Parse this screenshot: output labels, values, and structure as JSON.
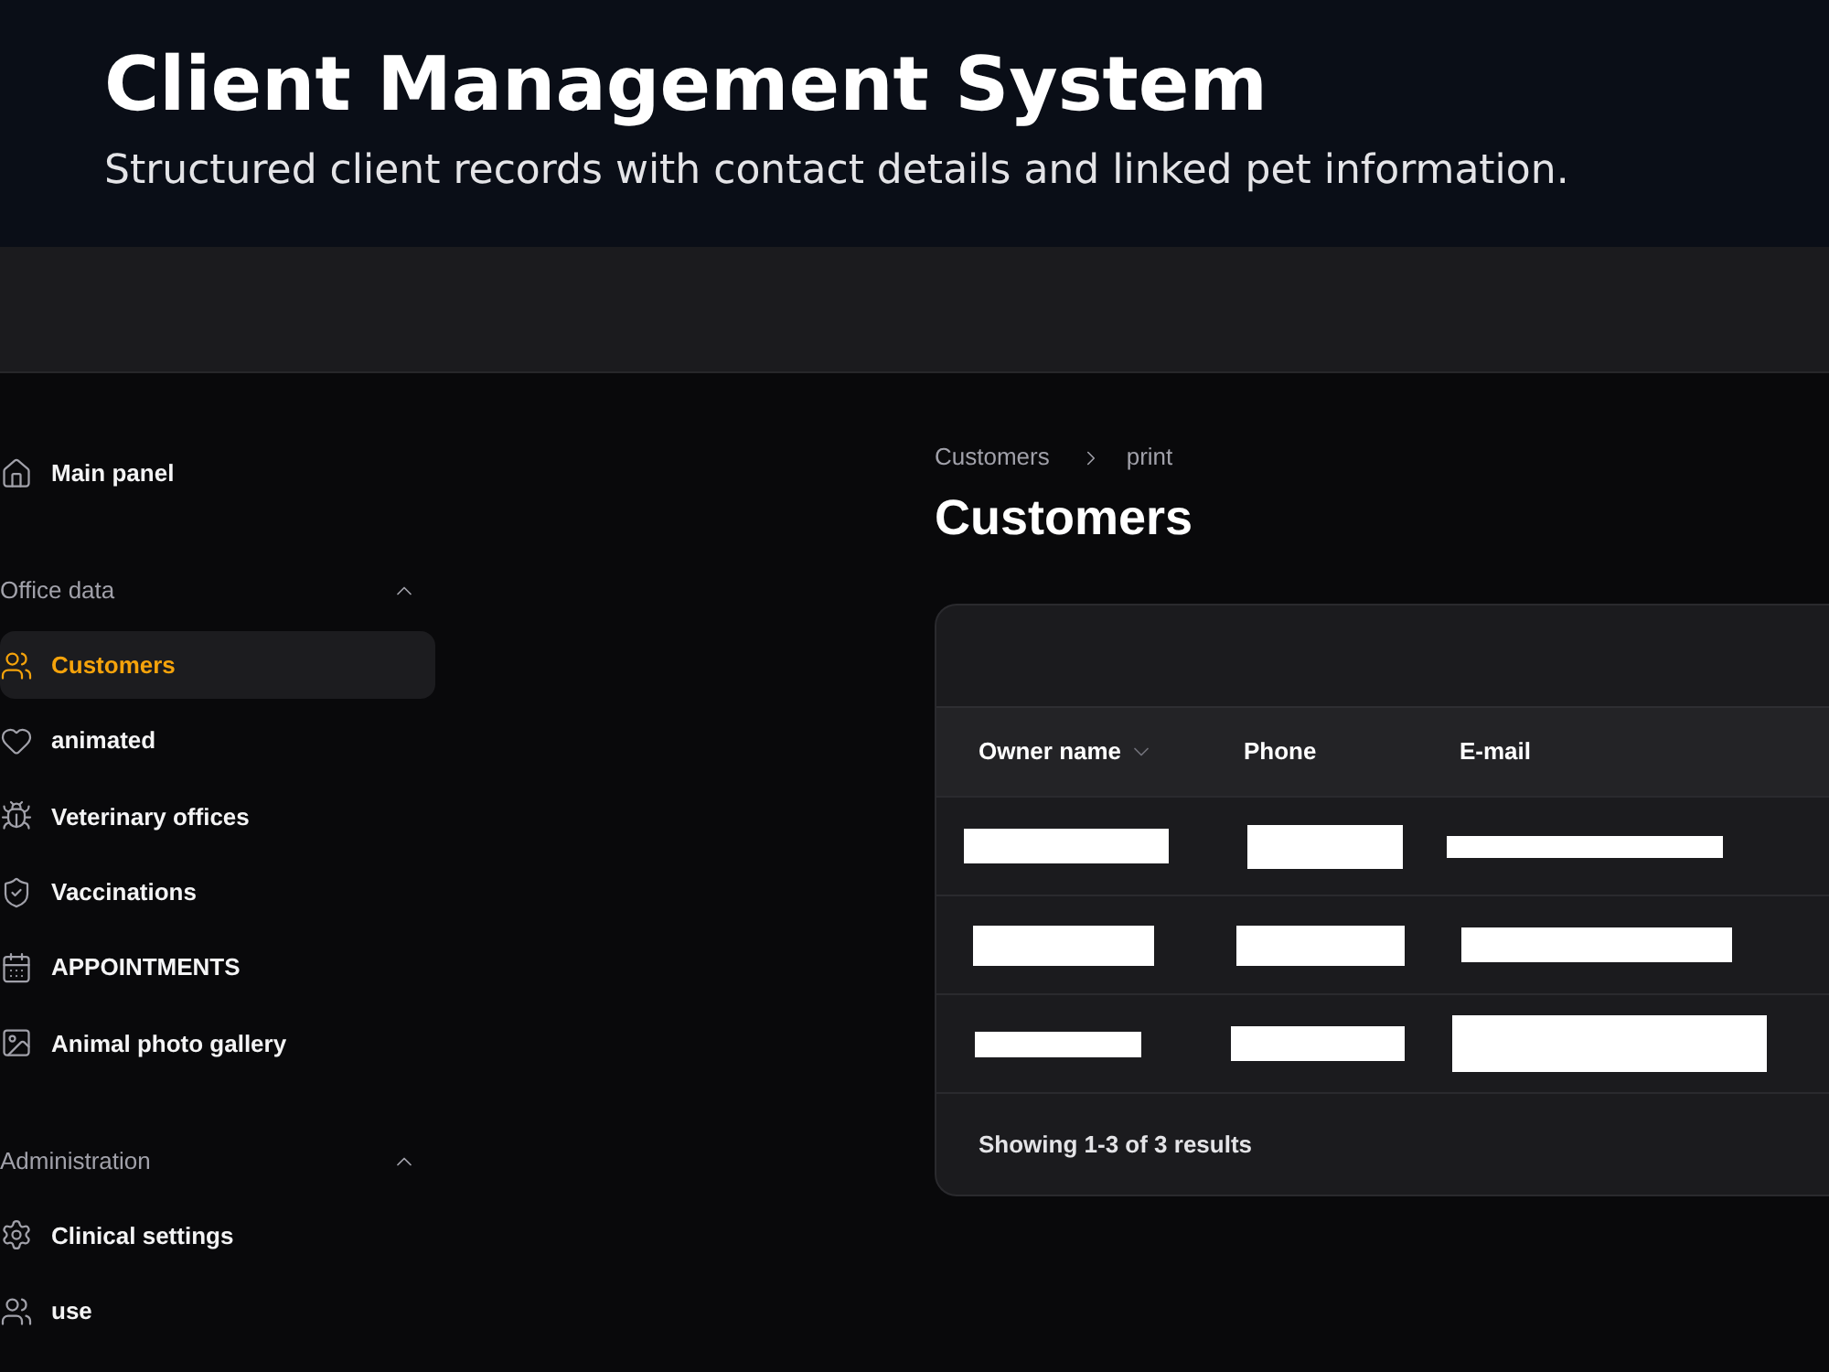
{
  "header": {
    "title": "Client Management System",
    "subtitle": "Structured client records with contact details and linked pet information."
  },
  "sidebar": {
    "items": [
      {
        "label": "Main panel",
        "selected": false
      }
    ],
    "groups": [
      {
        "label": "Office data",
        "expanded": true,
        "items": [
          {
            "label": "Customers",
            "selected": true
          },
          {
            "label": "animated",
            "selected": false
          },
          {
            "label": "Veterinary offices",
            "selected": false
          },
          {
            "label": "Vaccinations",
            "selected": false
          },
          {
            "label": "APPOINTMENTS",
            "selected": false
          },
          {
            "label": "Animal photo gallery",
            "selected": false
          }
        ]
      },
      {
        "label": "Administration",
        "expanded": true,
        "items": [
          {
            "label": "Clinical settings",
            "selected": false
          },
          {
            "label": "use",
            "selected": false
          }
        ]
      }
    ]
  },
  "breadcrumb": [
    "Customers",
    "print"
  ],
  "page_title": "Customers",
  "table": {
    "columns": [
      {
        "label": "Owner name",
        "sorted": true
      },
      {
        "label": "Phone",
        "sorted": false
      },
      {
        "label": "E-mail",
        "sorted": false
      }
    ],
    "rows": [
      {
        "cells": [
          {
            "redacted": true
          },
          {
            "redacted": true
          },
          {
            "redacted": true
          }
        ]
      },
      {
        "cells": [
          {
            "redacted": true
          },
          {
            "redacted": true
          },
          {
            "redacted": true
          }
        ]
      },
      {
        "cells": [
          {
            "redacted": true
          },
          {
            "redacted": true
          },
          {
            "redacted": true
          }
        ]
      }
    ],
    "footer": "Showing 1-3 of 3 results"
  }
}
